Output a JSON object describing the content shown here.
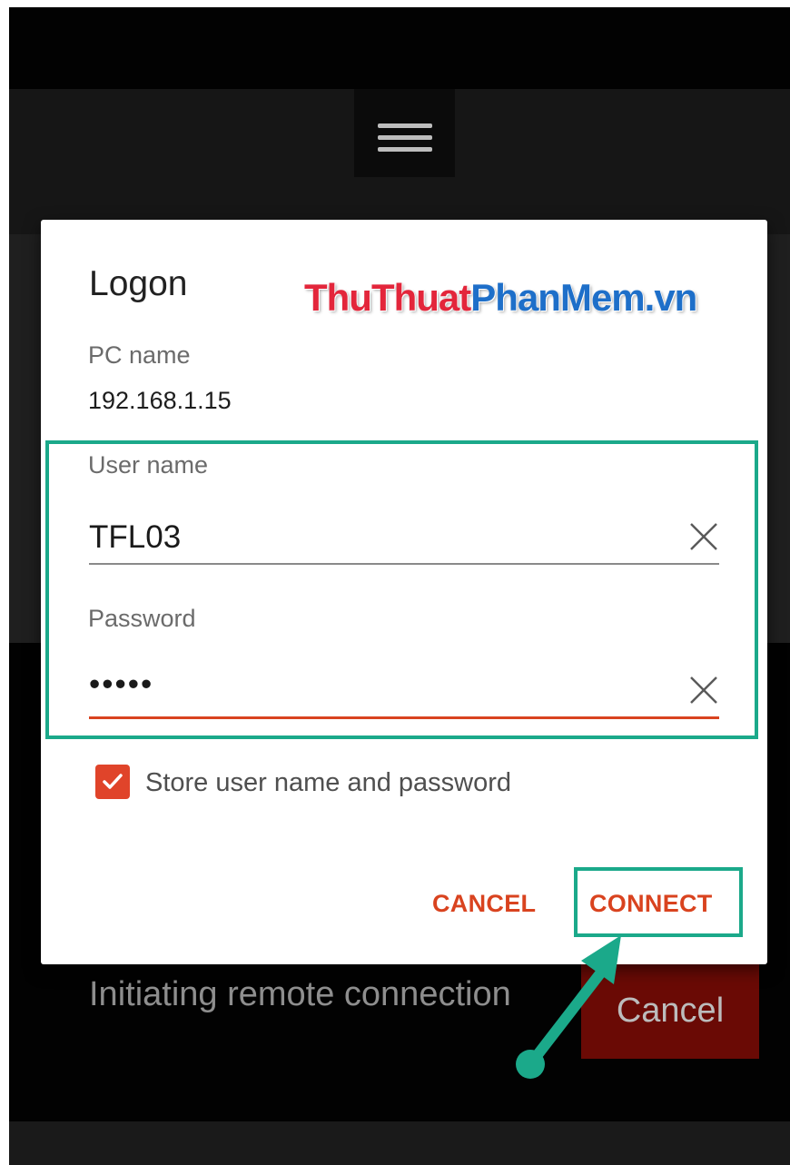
{
  "dialog": {
    "title": "Logon",
    "pc_name_label": "PC name",
    "pc_name_value": "192.168.1.15",
    "username_label": "User name",
    "username_value": "TFL03",
    "password_label": "Password",
    "password_value": "•••••",
    "store_checkbox_label": "Store user name and password",
    "store_checked": true,
    "cancel_label": "CANCEL",
    "connect_label": "CONNECT"
  },
  "background": {
    "status_text": "Initiating remote connection",
    "cancel_label": "Cancel"
  },
  "watermark": {
    "part1": "ThuThuat",
    "part2": "PhanMem.vn"
  },
  "icons": {
    "menu": "hamburger-menu-icon",
    "clear": "close-icon",
    "checkbox": "checkmark-icon",
    "annotation": "arrow-pointer-icon"
  },
  "colors": {
    "accent": "#d9431f",
    "highlight": "#1ba98a",
    "cancel_bg": "#6a0a05"
  }
}
